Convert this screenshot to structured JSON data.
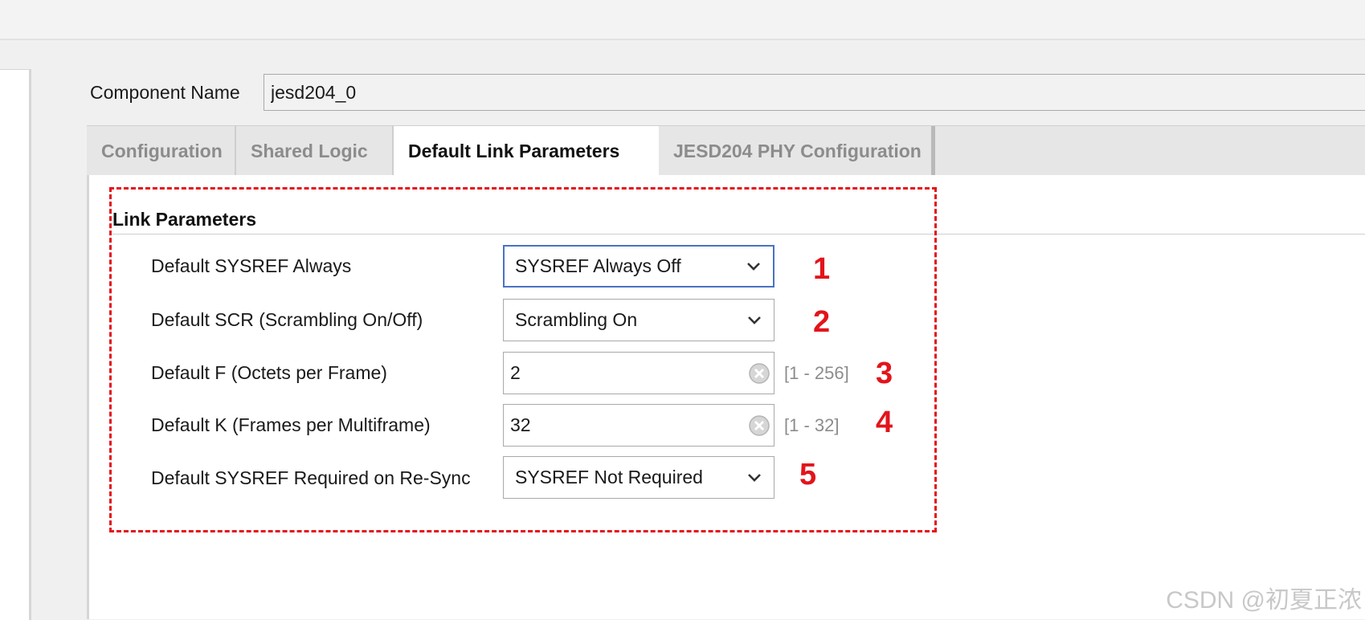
{
  "component": {
    "label": "Component Name",
    "value": "jesd204_0"
  },
  "tabs": [
    {
      "label": "Configuration",
      "active": false
    },
    {
      "label": "Shared Logic",
      "active": false
    },
    {
      "label": "Default Link Parameters",
      "active": true
    },
    {
      "label": "JESD204 PHY Configuration",
      "active": false
    }
  ],
  "section": {
    "title": "Link Parameters"
  },
  "params": [
    {
      "label": "Default SYSREF Always",
      "type": "select",
      "value": "SYSREF Always Off",
      "annotation": "1"
    },
    {
      "label": "Default SCR (Scrambling On/Off)",
      "type": "select",
      "value": "Scrambling On",
      "annotation": "2"
    },
    {
      "label": "Default F (Octets per Frame)",
      "type": "text",
      "value": "2",
      "range": "[1 - 256]",
      "annotation": "3"
    },
    {
      "label": "Default K (Frames per Multiframe)",
      "type": "text",
      "value": "32",
      "range": "[1 - 32]",
      "annotation": "4"
    },
    {
      "label": "Default SYSREF Required on Re-Sync",
      "type": "select",
      "value": "SYSREF Not Required",
      "annotation": "5"
    }
  ],
  "watermark": "CSDN @初夏正浓",
  "colors": {
    "annotation_red": "#e3141b",
    "focus_blue": "#4a72c4",
    "range_gray": "#8c8c8c"
  },
  "icons": {
    "dropdown": "chevron-down-icon",
    "clear": "clear-circle-icon"
  }
}
